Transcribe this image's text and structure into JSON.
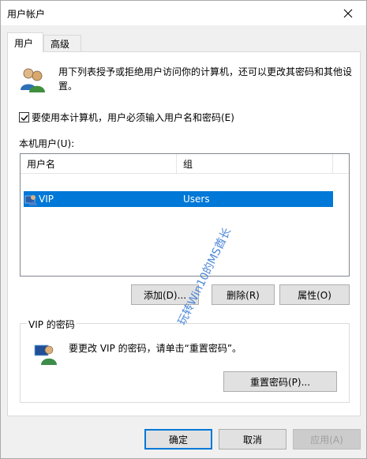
{
  "window": {
    "title": "用户帐户"
  },
  "tabs": [
    {
      "label": "用户",
      "active": true
    },
    {
      "label": "高级",
      "active": false
    }
  ],
  "intro": {
    "text": "用下列表授予或拒绝用户访问你的计算机，还可以更改其密码和其他设置。"
  },
  "require_password": {
    "checked": true,
    "label": "要使用本计算机，用户必须输入用户名和密码(E)"
  },
  "local_users": {
    "label": "本机用户(U):",
    "columns": [
      "用户名",
      "组"
    ],
    "rows": [
      {
        "name": "VIP",
        "group": "Users",
        "selected": true
      }
    ]
  },
  "buttons": {
    "add": "添加(D)...",
    "remove": "删除(R)",
    "properties": "属性(O)"
  },
  "password_section": {
    "title": "VIP 的密码",
    "text": "要更改 VIP 的密码，请单击“重置密码”。",
    "reset_button": "重置密码(P)..."
  },
  "footer": {
    "ok": "确定",
    "cancel": "取消",
    "apply": "应用(A)"
  },
  "watermark": "玩转Win10的MS酋长",
  "colors": {
    "selection": "#0078d7",
    "dialog_bg": "#f0f0f0",
    "button_bg": "#e1e1e1"
  },
  "icons": [
    "users-group-icon",
    "close-icon",
    "check-icon",
    "user-icon",
    "user-password-icon"
  ]
}
